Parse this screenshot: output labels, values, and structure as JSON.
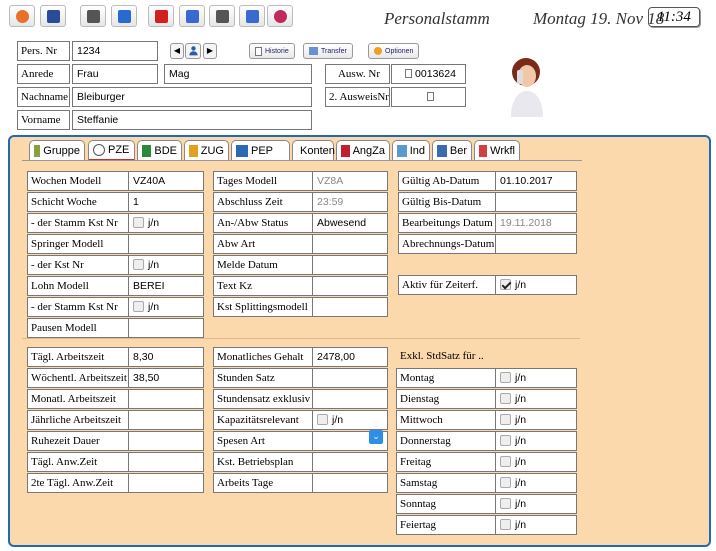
{
  "toolbar": {
    "buttons": [
      "home-icon",
      "save-icon",
      "copy-icon",
      "undo-icon",
      "delete-icon",
      "duplicate-icon",
      "print-icon",
      "filter-icon",
      "info-icon"
    ]
  },
  "title": "Personalstamm",
  "date": "Montag 19. Nov 18",
  "time": "11:34",
  "header": {
    "pers_nr_label": "Pers. Nr",
    "pers_nr": "1234",
    "historie": "Historie",
    "transfer": "Transfer",
    "optionen": "Optionen",
    "anrede_label": "Anrede",
    "anrede": "Frau",
    "titel": "Mag",
    "ausw_nr_label": "Ausw. Nr",
    "ausw_nr": "0013624",
    "ausweis2_label": "2. AusweisNr",
    "nachname_label": "Nachname",
    "nachname": "Bleiburger",
    "vorname_label": "Vorname",
    "vorname": "Steffanie"
  },
  "tabs": [
    "Gruppe",
    "PZE",
    "BDE",
    "ZUG",
    "PEP",
    "Konten",
    "AngZa",
    "Ind",
    "Ber",
    "Wrkfl"
  ],
  "checkbox_text": "j/n",
  "colors": {
    "accent": "#1e6ab4",
    "panel": "#fcd8ad"
  },
  "section1": {
    "col1": [
      {
        "label": "Wochen Modell",
        "value": "VZ40A"
      },
      {
        "label": "Schicht Woche",
        "value": "1"
      },
      {
        "label": "- der Stamm Kst Nr",
        "checkbox": false
      },
      {
        "label": "Springer Modell",
        "value": ""
      },
      {
        "label": "- der Kst Nr",
        "checkbox": false
      },
      {
        "label": "Lohn Modell",
        "value": "BEREI"
      },
      {
        "label": "- der Stamm Kst Nr",
        "checkbox": false
      },
      {
        "label": "Pausen Modell",
        "value": ""
      }
    ],
    "col2": [
      {
        "label": "Tages Modell",
        "value": "VZ8A"
      },
      {
        "label": "Abschluss Zeit",
        "value": "23:59"
      },
      {
        "label": "An-/Abw Status",
        "value": "Abwesend"
      },
      {
        "label": "Abw Art",
        "value": ""
      },
      {
        "label": "Melde Datum",
        "value": ""
      },
      {
        "label": "Text Kz",
        "value": ""
      },
      {
        "label": "Kst Splittingsmodell",
        "value": ""
      }
    ],
    "col3": [
      {
        "label": "Gültig Ab-Datum",
        "value": "01.10.2017"
      },
      {
        "label": "Gültig Bis-Datum",
        "value": ""
      },
      {
        "label": "Bearbeitungs Datum",
        "value": "19.11.2018"
      },
      {
        "label": "Abrechnungs-Datum",
        "value": ""
      }
    ],
    "aktiv_label": "Aktiv für Zeiterf."
  },
  "section2": {
    "col1": [
      {
        "label": "Tägl. Arbeitszeit",
        "value": "8,30"
      },
      {
        "label": "Wöchentl. Arbeitszeit",
        "value": "38,50"
      },
      {
        "label": "Monatl. Arbeitszeit",
        "value": ""
      },
      {
        "label": "Jährliche Arbeitszeit",
        "value": ""
      },
      {
        "label": "Ruhezeit Dauer",
        "value": ""
      },
      {
        "label": "Tägl. Anw.Zeit",
        "value": ""
      },
      {
        "label": "2te Tägl. Anw.Zeit",
        "value": ""
      }
    ],
    "col2": [
      {
        "label": "Monatliches Gehalt",
        "value": "2478,00"
      },
      {
        "label": "Stunden Satz",
        "value": ""
      },
      {
        "label": "Stundensatz exklusiv",
        "value": ""
      },
      {
        "label": "Kapazitätsrelevant",
        "checkbox": false
      },
      {
        "label": "Spesen Art",
        "value": ""
      },
      {
        "label": "Kst. Betriebsplan",
        "value": ""
      },
      {
        "label": "Arbeits Tage",
        "value": ""
      }
    ],
    "exkl_label": "Exkl. StdSatz für ..",
    "days": [
      "Montag",
      "Dienstag",
      "Mittwoch",
      "Donnerstag",
      "Freitag",
      "Samstag",
      "Sonntag",
      "Feiertag"
    ]
  }
}
